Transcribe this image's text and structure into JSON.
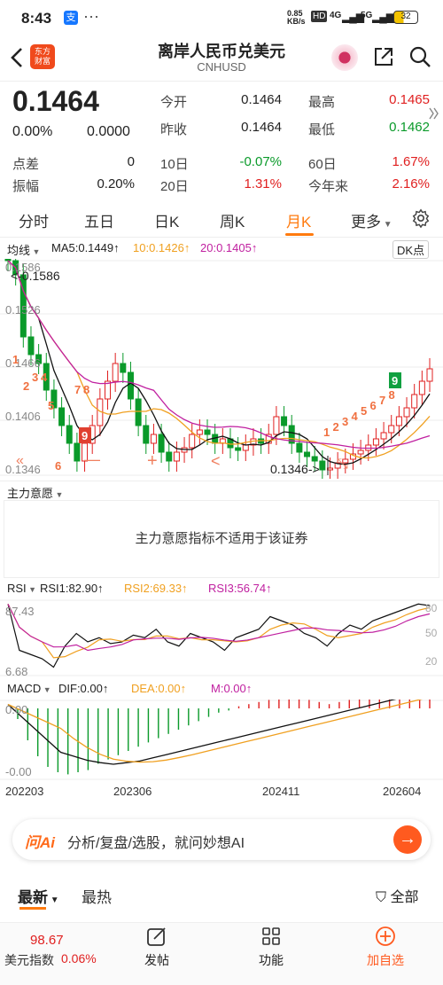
{
  "status": {
    "time": "8:43",
    "net_speed": "0.85\nKB/s",
    "hd": "HD",
    "net": "4G",
    "net2": "5G",
    "battery": "32"
  },
  "header": {
    "back_icon": "chevron-left-icon",
    "logo_text": "东方\n财富",
    "title": "离岸人民币兑美元",
    "code": "CNHUSD"
  },
  "quote": {
    "price": "0.1464",
    "change_pct": "0.00%",
    "change": "0.0000",
    "open_label": "今开",
    "open": "0.1464",
    "high_label": "最高",
    "high": "0.1465",
    "prev_label": "昨收",
    "prev": "0.1464",
    "low_label": "最低",
    "low": "0.1462",
    "spread_label": "点差",
    "spread": "0",
    "d10_label": "10日",
    "d10": "-0.07%",
    "d60_label": "60日",
    "d60": "1.67%",
    "amp_label": "振幅",
    "amp": "0.20%",
    "d20_label": "20日",
    "d20": "1.31%",
    "ytd_label": "今年来",
    "ytd": "2.16%"
  },
  "tabs": [
    "分时",
    "五日",
    "日K",
    "周K",
    "月K",
    "更多"
  ],
  "active_tab": 4,
  "chart": {
    "ma_label": "均线",
    "ma5": "MA5:0.1449",
    "ma10": "10:0.1426",
    "ma20": "20:0.1405",
    "dk": "DK点",
    "y_labels": [
      "0.1586",
      "0.1526",
      "0.1466",
      "0.1406",
      "0.1346"
    ],
    "max_annot": "<-0.1586",
    "min_annot": "0.1346->",
    "seq_red": [
      "1",
      "2",
      "3",
      "4",
      "7",
      "8",
      "9"
    ],
    "seq_up": [
      "1",
      "2",
      "3",
      "4",
      "5",
      "6",
      "7",
      "8"
    ],
    "seq_green": "9",
    "seq_left": [
      "5",
      "6"
    ]
  },
  "intent": {
    "title": "主力意愿",
    "message": "主力意愿指标不适用于该证券"
  },
  "rsi": {
    "label": "RSI",
    "rsi1": "RSI1:82.90",
    "rsi2": "RSI2:69.33",
    "rsi3": "RSI3:56.74",
    "top": "87.43",
    "bottom": "6.68",
    "r80": "80",
    "r50": "50",
    "r20": "20"
  },
  "macd": {
    "label": "MACD",
    "dif": "DIF:0.00",
    "dea": "DEA:0.00",
    "m": "M:0.00",
    "top": "0.00",
    "bottom": "-0.00",
    "dates": [
      "202203",
      "202306",
      "202411",
      "202604"
    ]
  },
  "ai": {
    "logo": "问Ai",
    "text": "分析/复盘/选股，就问妙想AI"
  },
  "news": {
    "tab_latest": "最新",
    "tab_hot": "最热",
    "filter": "全部"
  },
  "bottom": {
    "index_val": "98.67",
    "index_name": "美元指数",
    "index_pct": "0.06%",
    "post": "发帖",
    "func": "功能",
    "add": "加自选"
  },
  "colors": {
    "accent": "#ff7b0f",
    "up": "#e02020",
    "down": "#0a9a2a",
    "ma10": "#f0a020",
    "ma20": "#c020a0"
  }
}
